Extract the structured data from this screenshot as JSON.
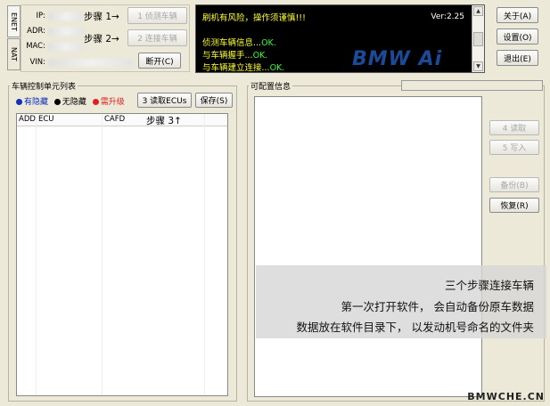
{
  "connection_panel": {
    "tabs": [
      "ENET",
      "NAT"
    ],
    "fields": [
      {
        "label": "IP:",
        "value": ""
      },
      {
        "label": "ADR:",
        "value": ""
      },
      {
        "label": "MAC:",
        "value": ""
      },
      {
        "label": "VIN:",
        "value": ""
      }
    ],
    "step1": "步骤 1→",
    "step2": "步骤 2→",
    "detect_button": "1 侦测车辆",
    "connect_button": "2 连接车辆",
    "disconnect_button": "断开(C)"
  },
  "console": {
    "warning": "刷机有风险，操作须谨慎!!!",
    "version": "Ver:2.25",
    "lines": [
      {
        "text": "侦测车辆信息...",
        "status": "OK."
      },
      {
        "text": "与车辆握手...",
        "status": "OK."
      },
      {
        "text": "与车辆建立连接...",
        "status": "OK."
      }
    ],
    "logo_text": "BMW Ai"
  },
  "right_buttons": {
    "about": "关于(A)",
    "settings": "设置(O)",
    "exit": "退出(E)"
  },
  "ecu_panel": {
    "title": "车辆控制单元列表",
    "legend": [
      {
        "label": "有隐藏",
        "color": "#1030c0"
      },
      {
        "label": "无隐藏",
        "color": "#000000"
      },
      {
        "label": "需升级",
        "color": "#e02020"
      }
    ],
    "read_button": "3 读取ECUs",
    "save_button": "保存(S)",
    "columns": [
      "ADD",
      "ECU",
      "CAFD"
    ],
    "step3": "步骤 3↑"
  },
  "config_panel": {
    "title": "可配置信息",
    "read_button": "4 读取",
    "write_button": "5 写入",
    "backup_button": "备份(B)",
    "restore_button": "恢复(R)"
  },
  "overlay": {
    "lines": [
      "三个步骤连接车辆",
      "第一次打开软件， 会自动备份原车数据",
      "数据放在软件目录下， 以发动机号命名的文件夹"
    ]
  },
  "watermark": "BMWCHE.CN"
}
